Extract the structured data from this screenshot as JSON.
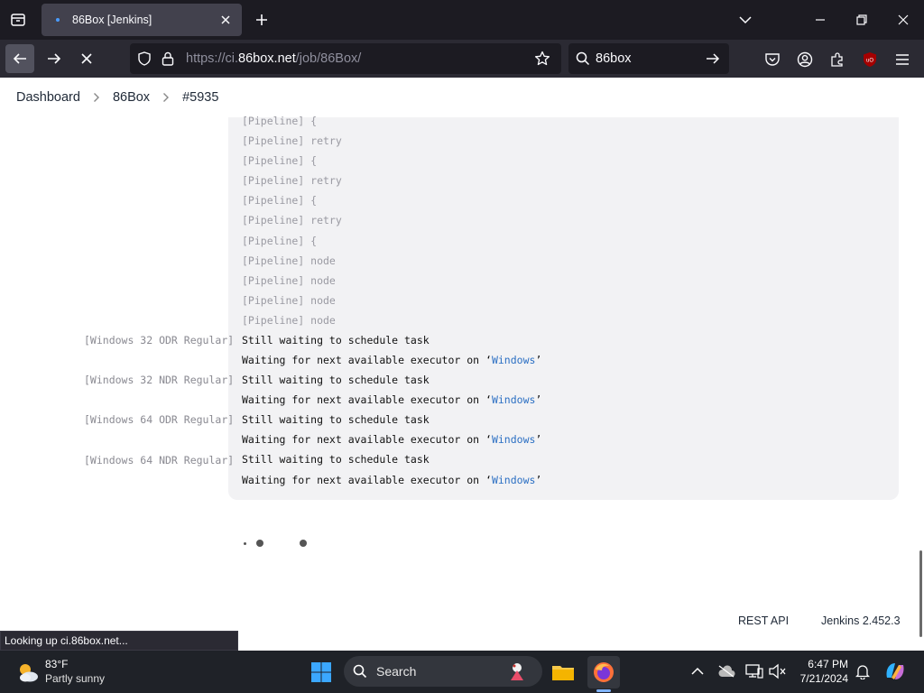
{
  "browser": {
    "tab": {
      "title": "86Box [Jenkins]"
    },
    "url": {
      "prefix": "https://ci.",
      "host": "86box.net",
      "path": "/job/86Box/"
    },
    "search": {
      "value": "86box"
    },
    "status_text": "Looking up ci.86box.net..."
  },
  "breadcrumb": [
    "Dashboard",
    "86Box",
    "#5935"
  ],
  "console": {
    "top_lines": [
      "[Pipeline] {",
      "[Pipeline] retry",
      "[Pipeline] {",
      "[Pipeline] retry",
      "[Pipeline] {",
      "[Pipeline] retry",
      "[Pipeline] {",
      "[Pipeline] node",
      "[Pipeline] node",
      "[Pipeline] node",
      "[Pipeline] node"
    ],
    "branches": [
      {
        "label": "[Windows 32 ODR Regular]",
        "line1": "Still waiting to schedule task",
        "line2_prefix": "Waiting for next available executor on ‘",
        "link": "Windows",
        "line2_suffix": "’"
      },
      {
        "label": "[Windows 32 NDR Regular]",
        "line1": "Still waiting to schedule task",
        "line2_prefix": "Waiting for next available executor on ‘",
        "link": "Windows",
        "line2_suffix": "’"
      },
      {
        "label": "[Windows 64 ODR Regular]",
        "line1": "Still waiting to schedule task",
        "line2_prefix": "Waiting for next available executor on ‘",
        "link": "Windows",
        "line2_suffix": "’"
      },
      {
        "label": "[Windows 64 NDR Regular]",
        "line1": "Still waiting to schedule task",
        "line2_prefix": "Waiting for next available executor on ‘",
        "link": "Windows",
        "line2_suffix": "’"
      }
    ]
  },
  "footer": {
    "rest_api": "REST API",
    "version": "Jenkins 2.452.3"
  },
  "taskbar": {
    "weather": {
      "temp": "83°F",
      "desc": "Partly sunny"
    },
    "search_label": "Search",
    "clock": {
      "time": "6:47 PM",
      "date": "7/21/2024"
    }
  },
  "colors": {
    "link": "#2b6fc3",
    "tab_bg": "#42414d",
    "chrome_bg": "#1c1b22",
    "toolbar_bg": "#2b2a33"
  }
}
